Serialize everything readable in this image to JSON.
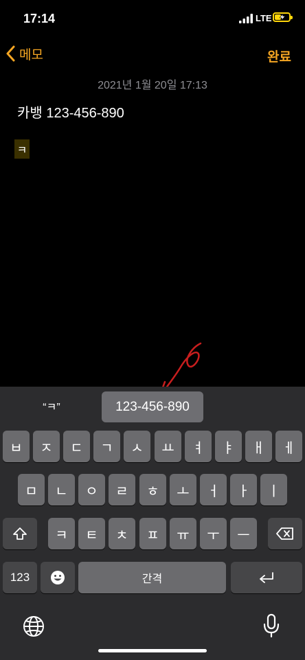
{
  "status": {
    "time": "17:14",
    "network": "LTE"
  },
  "nav": {
    "back_label": "메모",
    "done_label": "완료"
  },
  "note": {
    "date": "2021년 1월 20일 17:13",
    "line1": "카뱅 123-456-890",
    "composing": "ㅋ"
  },
  "keyboard": {
    "suggestions": [
      "“ㅋ”",
      "123-456-890"
    ],
    "row1": [
      "ㅂ",
      "ㅈ",
      "ㄷ",
      "ㄱ",
      "ㅅ",
      "ㅛ",
      "ㅕ",
      "ㅑ",
      "ㅐ",
      "ㅔ"
    ],
    "row2": [
      "ㅁ",
      "ㄴ",
      "ㅇ",
      "ㄹ",
      "ㅎ",
      "ㅗ",
      "ㅓ",
      "ㅏ",
      "ㅣ"
    ],
    "row3": [
      "ㅋ",
      "ㅌ",
      "ㅊ",
      "ㅍ",
      "ㅠ",
      "ㅜ",
      "ㅡ"
    ],
    "numbers_label": "123",
    "space_label": "간격",
    "icons": {
      "shift": "shift-icon",
      "delete": "delete-icon",
      "emoji": "emoji-icon",
      "return": "return-icon",
      "globe": "globe-icon",
      "mic": "mic-icon"
    }
  },
  "colors": {
    "accent": "#f5a623",
    "background": "#000000",
    "keyboard_bg": "#2c2c2e",
    "key": "#6b6b6e",
    "key_dark": "#464648",
    "annotation": "#c81e1e"
  }
}
